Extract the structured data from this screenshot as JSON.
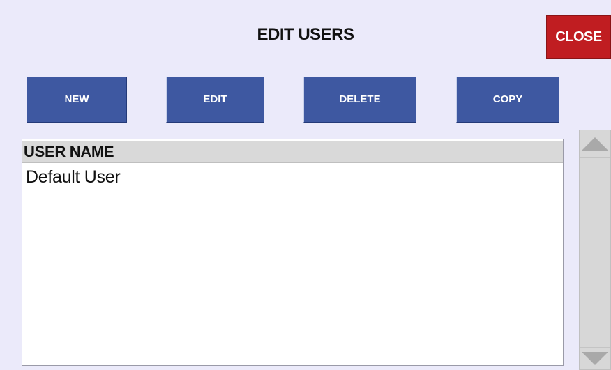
{
  "window": {
    "title": "EDIT USERS",
    "close_label": "CLOSE"
  },
  "toolbar": {
    "new_label": "NEW",
    "edit_label": "EDIT",
    "delete_label": "DELETE",
    "copy_label": "COPY"
  },
  "user_list": {
    "header": "USER NAME",
    "rows": [
      "Default User"
    ]
  },
  "scrollbar": {
    "up_icon": "triangle-up-icon",
    "down_icon": "triangle-down-icon"
  },
  "colors": {
    "background": "#ebeafa",
    "button": "#3e58a1",
    "close_button": "#c01d21",
    "header_row": "#d9d9d9",
    "scrollbar": "#d7d7d7"
  }
}
